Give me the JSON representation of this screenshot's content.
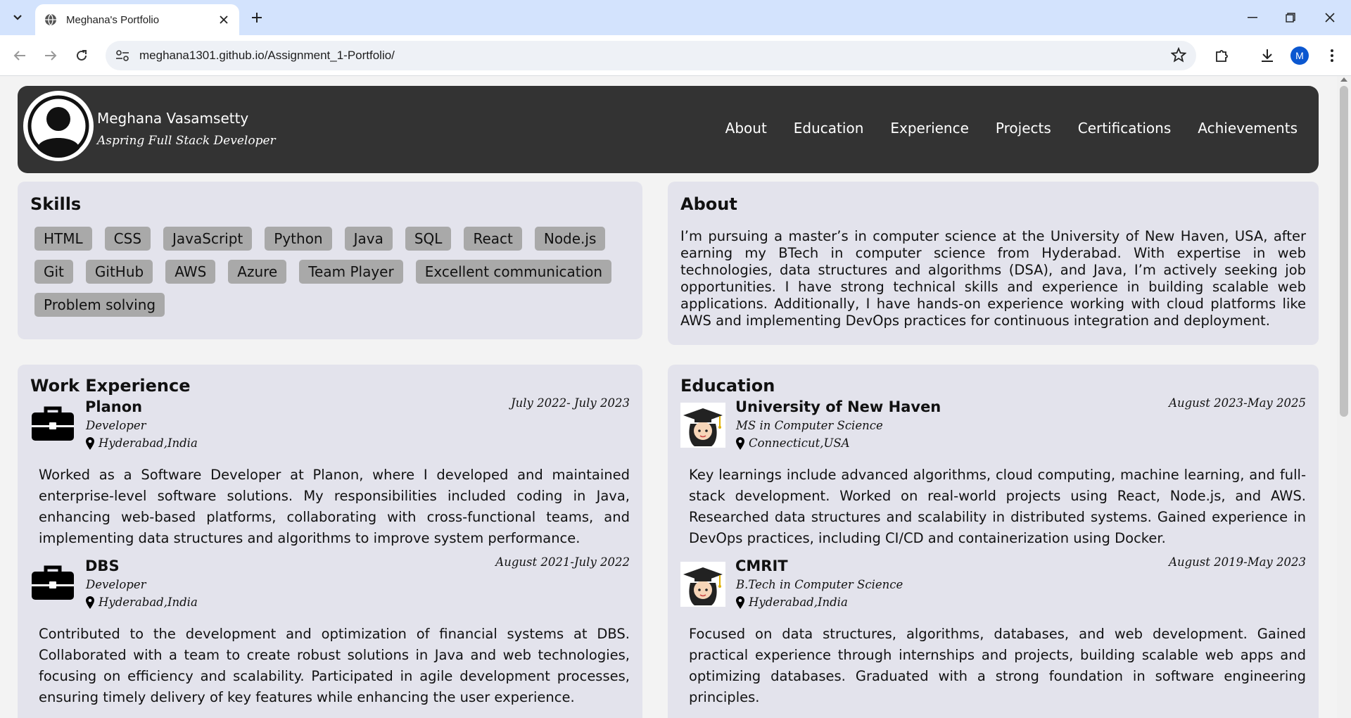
{
  "browser": {
    "tab_title": "Meghana's Portfolio",
    "url": "meghana1301.github.io/Assignment_1-Portfolio/",
    "profile_initial": "M"
  },
  "header": {
    "name": "Meghana Vasamsetty",
    "role": "Aspring Full Stack Developer",
    "nav": [
      "About",
      "Education",
      "Experience",
      "Projects",
      "Certifications",
      "Achievements"
    ]
  },
  "skills": {
    "title": "Skills",
    "items": [
      "HTML",
      "CSS",
      "JavaScript",
      "Python",
      "Java",
      "SQL",
      "React",
      "Node.js",
      "Git",
      "GitHub",
      "AWS",
      "Azure",
      "Team Player",
      "Excellent communication",
      "Problem solving"
    ]
  },
  "about": {
    "title": "About",
    "text": "I’m pursuing a master’s in computer science at the University of New Haven, USA, after earning my BTech in computer science from Hyderabad. With expertise in web technologies, data structures and algorithms (DSA), and Java, I’m actively seeking job opportunities. I have strong technical skills and experience in building scalable web applications. Additionally, I have hands-on experience working with cloud platforms like AWS and implementing DevOps practices for continuous integration and deployment."
  },
  "work": {
    "title": "Work Experience",
    "entries": [
      {
        "org": "Planon",
        "role": "Developer",
        "location": "Hyderabad,India",
        "date": "July 2022- July 2023",
        "desc": "Worked as a Software Developer at Planon, where I developed and maintained enterprise-level software solutions. My responsibilities included coding in Java, enhancing web-based platforms, collaborating with cross-functional teams, and implementing data structures and algorithms to improve system performance."
      },
      {
        "org": "DBS",
        "role": "Developer",
        "location": "Hyderabad,India",
        "date": "August 2021-July 2022",
        "desc": "Contributed to the development and optimization of financial systems at DBS. Collaborated with a team to create robust solutions in Java and web technologies, focusing on efficiency and scalability. Participated in agile development processes, ensuring timely delivery of key features while enhancing the user experience."
      }
    ]
  },
  "education": {
    "title": "Education",
    "entries": [
      {
        "org": "University of New Haven",
        "role": "MS in Computer Science",
        "location": "Connecticut,USA",
        "date": "August 2023-May 2025",
        "desc": "Key learnings include advanced algorithms, cloud computing, machine learning, and full-stack development. Worked on real-world projects using React, Node.js, and AWS. Researched data structures and scalability in distributed systems. Gained experience in DevOps practices, including CI/CD and containerization using Docker."
      },
      {
        "org": "CMRIT",
        "role": "B.Tech in Computer Science",
        "location": "Hyderabad,India",
        "date": "August 2019-May 2023",
        "desc": "Focused on data structures, algorithms, databases, and web development. Gained practical experience through internships and projects, building scalable web apps and optimizing databases. Graduated with a strong foundation in software engineering principles."
      }
    ]
  }
}
